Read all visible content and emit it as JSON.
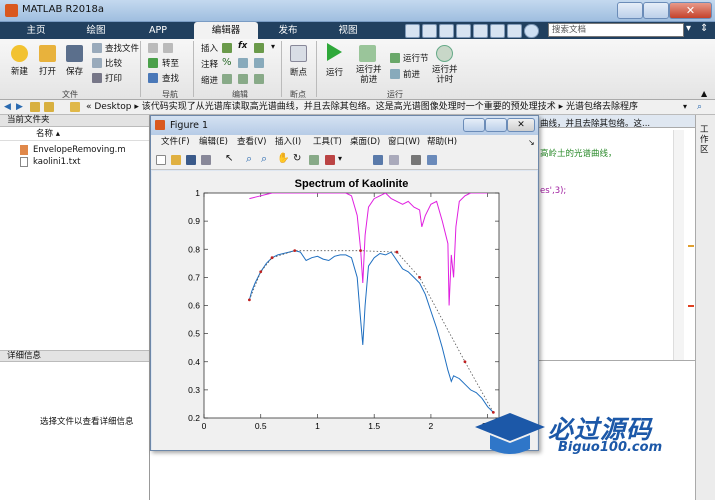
{
  "window": {
    "title": "MATLAB R2018a"
  },
  "tabs": [
    "主页",
    "绘图",
    "APP",
    "编辑器",
    "发布",
    "视图"
  ],
  "search": {
    "placeholder": "搜索文档"
  },
  "ribbon": {
    "file_group": {
      "label": "文件",
      "new": "新建",
      "open": "打开",
      "save": "保存",
      "find_files": "查找文件",
      "compare": "比较",
      "print": "打印"
    },
    "nav_group": {
      "label": "导航",
      "goto": "转至",
      "find": "查找"
    },
    "edit_group": {
      "label": "编辑",
      "insert": "插入",
      "comment": "注释",
      "indent": "缩进",
      "fx": "fx"
    },
    "breakpoint_group": {
      "label": "断点",
      "breakpoints": "断点"
    },
    "run_group": {
      "label": "运行",
      "run": "运行",
      "run_advance": "运行并\n前进",
      "run_section": "运行节",
      "advance": "前进",
      "run_time": "运行并\n计时"
    }
  },
  "addressbar": {
    "path": [
      "Desktop",
      "该代码实现了从光谱库读取高光谱曲线，并且去除其包络。这是高光谱图像处理时一个重要的预处理技术",
      "光谱包络去除程序"
    ]
  },
  "left_pane": {
    "current_folder": "当前文件夹",
    "name_col": "名称",
    "files": [
      "EnvelopeRemoving.m",
      "kaolini1.txt"
    ],
    "details_title": "详细信息",
    "details_hint": "选择文件以查看详细信息"
  },
  "editor": {
    "visible_text": [
      "曲线，并且去除其包络。这...",
      "高岭土的光谱曲线，",
      "es',3);"
    ],
    "right_tab": "工作区"
  },
  "figure": {
    "title": "Figure 1",
    "menus": [
      "文件(F)",
      "编辑(E)",
      "查看(V)",
      "插入(I)",
      "工具(T)",
      "桌面(D)",
      "窗口(W)",
      "帮助(H)"
    ]
  },
  "chart_data": {
    "type": "line",
    "title": "Spectrum of Kaolinite",
    "xlabel": "",
    "ylabel": "",
    "xlim": [
      0,
      2.6
    ],
    "ylim": [
      0.2,
      1
    ],
    "xticks": [
      0,
      0.5,
      1,
      1.5,
      2,
      2.5
    ],
    "yticks": [
      0.2,
      0.3,
      0.4,
      0.5,
      0.6,
      0.7,
      0.8,
      0.9,
      1
    ],
    "grid": false,
    "series": [
      {
        "color": "#e020e0",
        "x": [
          0.4,
          0.45,
          0.5,
          0.55,
          0.6,
          0.65,
          0.7,
          0.75,
          0.8,
          0.85,
          0.9,
          0.95,
          1.0,
          1.05,
          1.1,
          1.15,
          1.2,
          1.25,
          1.3,
          1.35,
          1.38,
          1.4,
          1.42,
          1.45,
          1.5,
          1.55,
          1.6,
          1.65,
          1.7,
          1.75,
          1.8,
          1.85,
          1.9,
          1.92,
          1.95,
          2.0,
          2.05,
          2.1,
          2.15,
          2.16,
          2.18,
          2.2,
          2.22,
          2.25,
          2.3,
          2.35,
          2.4,
          2.45,
          2.5
        ],
        "y": [
          0.98,
          0.985,
          0.99,
          0.995,
          1.0,
          1.0,
          1.0,
          1.0,
          1.0,
          1.0,
          1.0,
          1.0,
          1.0,
          1.0,
          1.0,
          1.0,
          1.0,
          1.0,
          0.99,
          0.92,
          0.8,
          0.68,
          0.85,
          0.95,
          0.98,
          0.99,
          1.0,
          0.98,
          0.97,
          0.96,
          0.97,
          0.95,
          0.94,
          0.88,
          0.92,
          0.96,
          0.97,
          0.9,
          0.82,
          0.6,
          0.78,
          0.7,
          0.88,
          0.97,
          0.99,
          1.0,
          1.0,
          1.0,
          1.0
        ]
      },
      {
        "color": "#1f6fc0",
        "x": [
          0.4,
          0.42,
          0.45,
          0.5,
          0.55,
          0.6,
          0.65,
          0.7,
          0.75,
          0.8,
          0.85,
          0.9,
          0.95,
          1.0,
          1.05,
          1.1,
          1.15,
          1.2,
          1.25,
          1.3,
          1.35,
          1.38,
          1.4,
          1.42,
          1.45,
          1.5,
          1.55,
          1.6,
          1.65,
          1.7,
          1.75,
          1.8,
          1.85,
          1.9,
          1.95,
          2.0,
          2.05,
          2.1,
          2.15,
          2.18,
          2.2,
          2.25,
          2.3,
          2.35,
          2.4,
          2.45,
          2.5,
          2.55
        ],
        "y": [
          0.62,
          0.65,
          0.68,
          0.72,
          0.75,
          0.77,
          0.78,
          0.785,
          0.79,
          0.795,
          0.79,
          0.76,
          0.77,
          0.775,
          0.765,
          0.76,
          0.775,
          0.78,
          0.78,
          0.77,
          0.7,
          0.55,
          0.46,
          0.6,
          0.74,
          0.77,
          0.785,
          0.78,
          0.79,
          0.76,
          0.73,
          0.72,
          0.7,
          0.68,
          0.64,
          0.58,
          0.52,
          0.45,
          0.37,
          0.33,
          0.35,
          0.34,
          0.32,
          0.3,
          0.29,
          0.27,
          0.24,
          0.22
        ]
      },
      {
        "color": "#555555",
        "style": "dotted",
        "x": [
          0.4,
          0.5,
          0.6,
          0.8,
          1.38,
          1.7,
          1.9,
          2.3,
          2.55
        ],
        "y": [
          0.62,
          0.72,
          0.77,
          0.795,
          0.795,
          0.79,
          0.7,
          0.4,
          0.22
        ]
      }
    ]
  }
}
